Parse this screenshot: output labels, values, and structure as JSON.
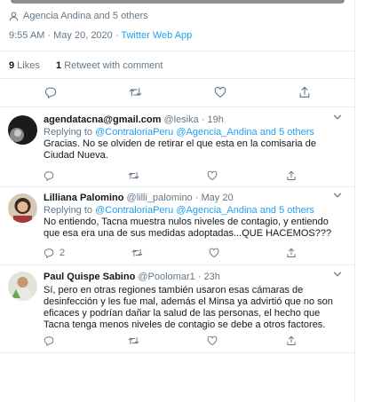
{
  "tweet": {
    "tagged": "Agencia Andina and 5 others",
    "time": "9:55 AM · May 20, 2020",
    "separator": " · ",
    "source": "Twitter Web App",
    "likes_count": "9",
    "likes_label": "Likes",
    "retweets_count": "1",
    "retweets_label": "Retweet with comment"
  },
  "replies": [
    {
      "name": "agendatacna@gmail.com",
      "handle": "@lesika",
      "time": "19h",
      "replying_prefix": "Replying to ",
      "mentions": "@ContraloriaPeru @Agencia_Andina and 5 others",
      "text": "Gracias. No se olviden de retirar el que esta en la comisaria de Ciudad Nueva.",
      "reply_count": ""
    },
    {
      "name": "Lilliana Palomino",
      "handle": "@lilli_palomino",
      "time": "May 20",
      "replying_prefix": "Replying to ",
      "mentions": "@ContraloriaPeru @Agencia_Andina and 5 others",
      "text": "No entiendo, Tacna muestra nulos niveles de contagio, y entiendo que esa era una de sus medidas adoptadas...QUE HACEMOS???",
      "reply_count": "2"
    },
    {
      "name": "Paul Quispe Sabino",
      "handle": "@Poolomar1",
      "time": "23h",
      "text": "Sí, pero en otras regiones también usaron esas cámaras de desinfección y les fue mal, además el Minsa ya advirtió que no son eficaces y podrían dañar la salud de las personas, el hecho que Tacna tenga menos niveles de contagio se debe a otros factores.",
      "reply_count": ""
    }
  ],
  "colors": {
    "accent": "#1da1f2",
    "muted": "#657786",
    "text": "#14171a",
    "divider": "#e6ecf0"
  },
  "icons": [
    "person-icon",
    "reply-icon",
    "retweet-icon",
    "like-icon",
    "share-icon",
    "chevron-down-icon"
  ]
}
